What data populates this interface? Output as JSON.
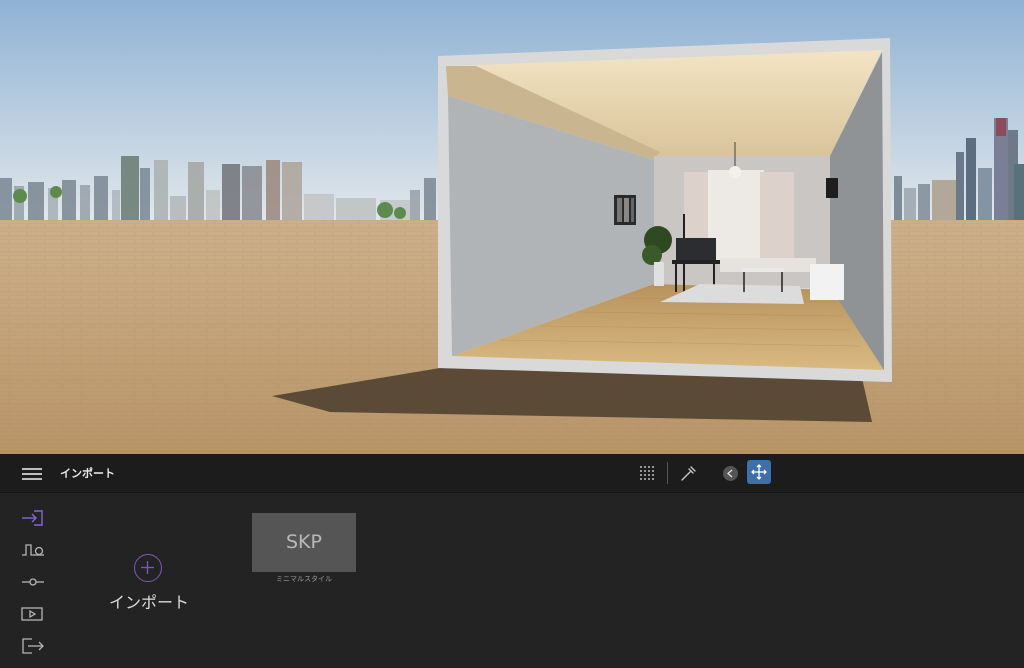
{
  "viewport": {
    "colors": {
      "sky_top": "#8fb2d4",
      "sky_bottom": "#e1e6ea",
      "ground": "#c2a27a",
      "wall": "#b8b9bb",
      "floor": "#caa86c",
      "ceiling": "#ead9b7"
    }
  },
  "toolbar": {
    "title": "インポート",
    "icons": {
      "menu": "hamburger-icon",
      "grid": "grid-icon",
      "eyedropper": "eyedropper-icon",
      "back": "back-arrow-icon",
      "move": "move-arrows-icon"
    },
    "accent": "#3e6fa8"
  },
  "sidebar": {
    "items": [
      {
        "icon": "import-icon",
        "color": "#8a64d6"
      },
      {
        "icon": "path-icon",
        "color": "#b5b5b5"
      },
      {
        "icon": "slider-icon",
        "color": "#b5b5b5"
      },
      {
        "icon": "play-icon",
        "color": "#b5b5b5"
      },
      {
        "icon": "export-icon",
        "color": "#b5b5b5"
      }
    ]
  },
  "import": {
    "label": "インポート",
    "accent": "#7e58c0"
  },
  "file_card": {
    "label": "SKP",
    "caption": "ミニマルスタイル"
  }
}
